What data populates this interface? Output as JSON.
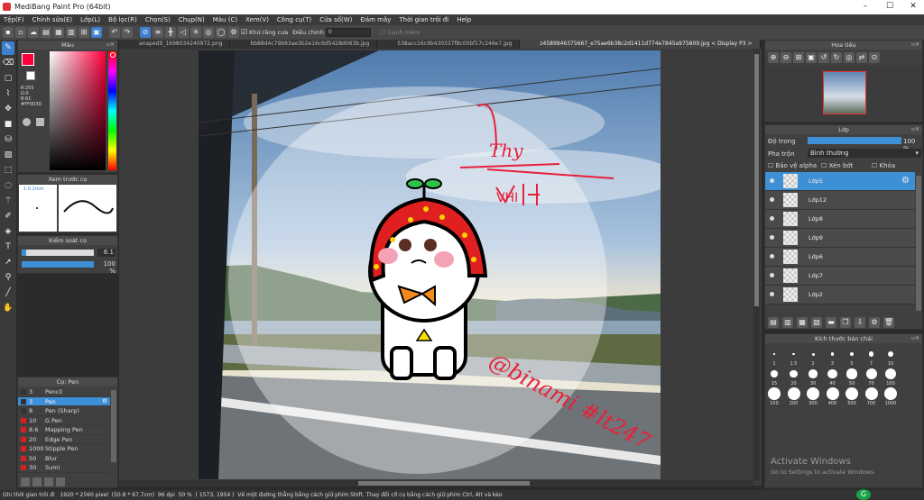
{
  "window": {
    "title": "MediBang Paint Pro (64bit)",
    "controls": [
      "–",
      "☐",
      "✕"
    ]
  },
  "menu": [
    "Tệp(F)",
    "Chỉnh sửa(E)",
    "Lớp(L)",
    "Bộ lọc(R)",
    "Chọn(S)",
    "Chụp(N)",
    "Màu (C)",
    "Xem(V)",
    "Công cụ(T)",
    "Cửa sổ(W)",
    "Đám mây",
    "Thời gian trôi đi",
    "Help"
  ],
  "toolbar": {
    "antialias_label": "Khử răng cưa",
    "correction_label": "Điều chỉnh",
    "correction_value": "0",
    "edge_label": "Cạnh mềm"
  },
  "tabs": [
    "anapedit_1698034240972.png",
    "bb88d4c79b93ae3b2e16c6d5428d063b.jpg",
    "538acc16c9b430337f8c00bf17c246e7.jpg",
    "z4589946375667_e75ae6b38c2d1411d774e7845a975809.jpg < Display P3 >"
  ],
  "color_panel": {
    "title": "Màu",
    "r": "R:255",
    "g": "G:0",
    "b": "B:61",
    "hex": "#FF003D",
    "main_color": "#ff003d"
  },
  "brush_preview": {
    "title": "Xem trước cọ",
    "size_label": "1.0.1mm"
  },
  "brush_control": {
    "title": "Kiểm soát cọ",
    "size": "6.1",
    "opacity": "100 %",
    "size_fraction": 0.06,
    "opacity_fraction": 1.0
  },
  "brush_panel": {
    "title": "Cọ: Pen",
    "items": [
      {
        "size": "3",
        "name": "Pencil",
        "color": "#333333"
      },
      {
        "size": "3",
        "name": "Pen",
        "color": "#333333",
        "selected": true
      },
      {
        "size": "8",
        "name": "Pen (Sharp)",
        "color": "#333333"
      },
      {
        "size": "10",
        "name": "G Pen",
        "color": "#d42020"
      },
      {
        "size": "8.6",
        "name": "Mapping Pen",
        "color": "#d42020"
      },
      {
        "size": "20",
        "name": "Edge Pen",
        "color": "#d42020"
      },
      {
        "size": "1000",
        "name": "Stipple Pen",
        "color": "#d42020"
      },
      {
        "size": "50",
        "name": "Blur",
        "color": "#d42020"
      },
      {
        "size": "30",
        "name": "Sumi",
        "color": "#d42020"
      }
    ]
  },
  "navigator": {
    "title": "Hoa tiêu"
  },
  "layer_panel": {
    "title": "Lớp",
    "opacity_label": "Độ trong",
    "opacity_value": "100 %",
    "opacity_fraction": 1.0,
    "blend_label": "Pha trộn",
    "blend_value": "Bình thường",
    "protect_alpha": "Bảo vệ alpha",
    "clipping": "Xén bớt",
    "lock": "Khóa",
    "layers": [
      "Lớp5",
      "Lớp12",
      "Lớp8",
      "Lớp9",
      "Lớp6",
      "Lớp7",
      "Lớp2"
    ]
  },
  "brush_size_panel": {
    "title": "Kích thước bản chải",
    "sizes": [
      "1",
      "1.5",
      "2",
      "3",
      "5",
      "7",
      "10",
      "15",
      "20",
      "30",
      "40",
      "50",
      "70",
      "100",
      "150",
      "200",
      "300",
      "400",
      "500",
      "700",
      "1000"
    ]
  },
  "artwork": {
    "signature_text": "Thy",
    "sub_text": "VHI",
    "handle_text": "@binami #lt247"
  },
  "watermark": {
    "title": "Activate Windows",
    "subtitle": "Go to Settings to activate Windows."
  },
  "status": {
    "label": "Ghi thời gian trôi đi",
    "dimensions": "1920 * 2560 pixel",
    "physical": "(50.8 * 67.7cm)",
    "dpi": "96 dpi",
    "zoom": "50 %",
    "coords": "( 1573, 1954 )",
    "hint": "Vẽ một đường thẳng bằng cách giữ phím Shift. Thay đổi cỡ cọ bằng cách giữ phím Ctrl, Alt và kéo"
  }
}
